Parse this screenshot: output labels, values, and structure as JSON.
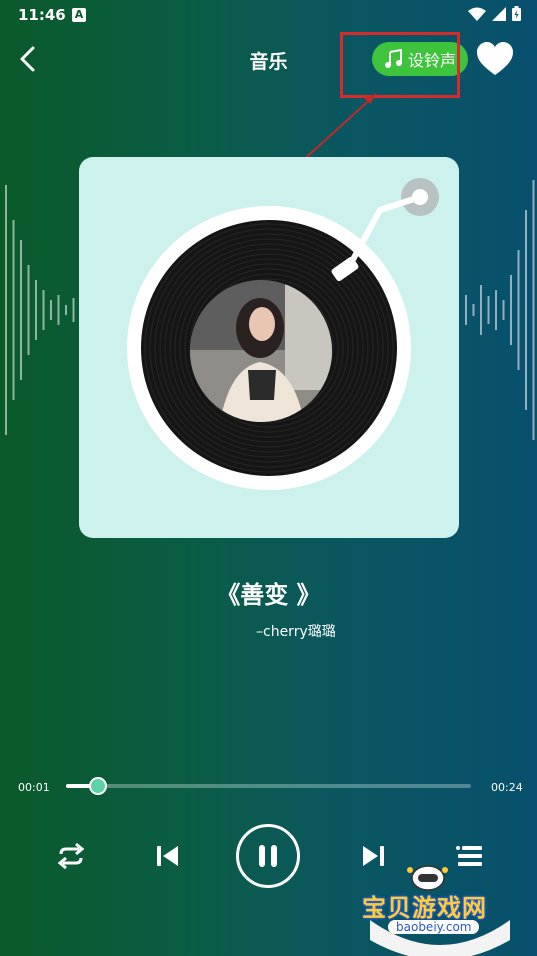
{
  "status_bar": {
    "time": "11:46",
    "notification_badge": "A",
    "icons": [
      "wifi-icon",
      "signal-icon",
      "battery-icon"
    ]
  },
  "header": {
    "title": "音乐",
    "back_icon": "chevron-left-icon",
    "set_ringtone_label": "设铃声",
    "favorite_icon": "heart-icon"
  },
  "song": {
    "title": "《善变 》",
    "artist": "–cherry璐璐"
  },
  "player": {
    "current_time": "00:01",
    "total_time": "00:24",
    "progress_fraction": 0.078,
    "controls": [
      "repeat-icon",
      "previous-icon",
      "pause-icon",
      "next-icon",
      "playlist-icon"
    ]
  },
  "watermark": {
    "brand": "宝贝游戏网",
    "url": "baobeiy.com"
  },
  "colors": {
    "accent_green": "#3ec33c",
    "highlight_red": "#d62b2b",
    "thumb": "#5cd3a7",
    "card_bg": "#cdf2ee"
  }
}
